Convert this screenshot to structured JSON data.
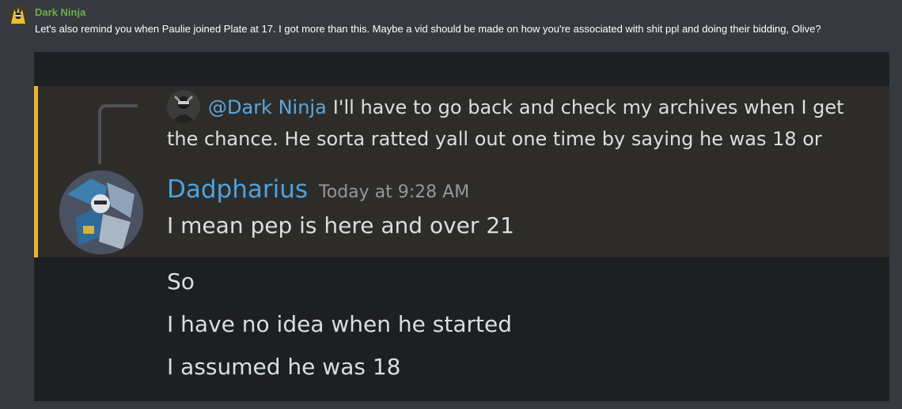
{
  "post": {
    "author": "Dark Ninja",
    "text": "Let's also remind you when Paulie joined Plate at 17. I got more than this. Maybe a vid should be made on how you're associated with shit ppl and doing their bidding, Olive?"
  },
  "embed": {
    "reply": {
      "mention": "@Dark Ninja",
      "text": "I'll have to go back and check my archives when I get the chance. He sorta ratted yall out one time by saying he was 18 or"
    },
    "message": {
      "username": "Dadpharius",
      "timestamp": "Today at 9:28 AM",
      "lines": [
        "I mean pep is here and over 21",
        "So",
        "I have no idea when he started",
        "I assumed he was 18"
      ]
    }
  },
  "colors": {
    "author_green": "#6cae4a",
    "username_blue": "#4ba3e3",
    "mention_blue": "#5aa7e0",
    "highlight_gold": "#f0b232"
  }
}
